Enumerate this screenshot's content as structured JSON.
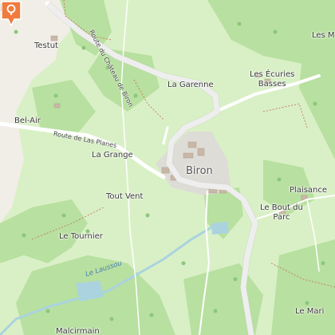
{
  "places": {
    "testut": "Testut",
    "bel_air": "Bel-Air",
    "la_garenne": "La Garenne",
    "les_ecuries_1": "Les Écuries",
    "les_ecuries_2": "Basses",
    "les_m": "Les M",
    "la_grange": "La Grange",
    "biron": "Biron",
    "tout_vent": "Tout Vent",
    "plaisance": "Plaisance",
    "le_bout_1": "Le Bout du",
    "le_bout_2": "Parc",
    "le_tournier": "Le Tournier",
    "le_mariol": "Le Mari",
    "malcirmain": "Malcirmain"
  },
  "roads": {
    "chateau": "Route du Château de Biron",
    "planes": "Route de Las Planes"
  },
  "water": {
    "lausso": "Le Laussou"
  },
  "icons": {
    "marker": "location-pin-icon",
    "castle": "castle-icon"
  },
  "colors": {
    "marker": "#f07b3f",
    "forest": "#b8e0a0",
    "meadow": "#d9f0c6",
    "farmland": "#f1eee7",
    "water": "#aad3df",
    "road": "#ffffff"
  }
}
